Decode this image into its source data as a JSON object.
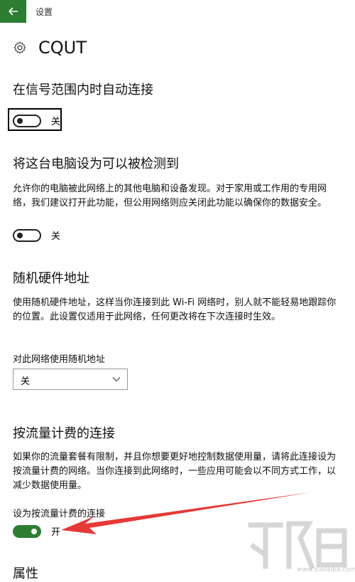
{
  "window": {
    "title": "设置"
  },
  "network": {
    "name": "CQUT"
  },
  "sections": {
    "auto_connect": {
      "title": "在信号范围内时自动连接",
      "toggle_label": "关"
    },
    "discoverable": {
      "title": "将这台电脑设为可以被检测到",
      "description": "允许你的电脑被此网络上的其他电脑和设备发现。对于家用或工作用的专用网络，我们建议打开此功能，但公用网络则应关闭此功能以确保你的数据安全。",
      "toggle_label": "关"
    },
    "random_mac": {
      "title": "随机硬件地址",
      "description": "使用随机硬件地址，这样当你连接到此 Wi-Fi 网络时，别人就不能轻易地跟踪你的位置。此设置仅适用于此网络，任何更改将在下次连接时生效。",
      "dropdown_label": "对此网络使用随机地址",
      "dropdown_value": "关"
    },
    "metered": {
      "title": "按流量计费的连接",
      "description": "如果你的流量套餐有限制，并且你想要更好地控制数据使用量，请将此连接设为按流量计费的网络。当你连接到此网络时，一些应用可能会以不同方式工作，以减少数据使用量。",
      "toggle_caption": "设为按流量计费的连接",
      "toggle_label": "开"
    },
    "properties": {
      "title": "属性"
    }
  },
  "watermark": {
    "text": "www.xiazaiba.com"
  },
  "colors": {
    "accent": "#2d7d32",
    "annotation_arrow": "#e53935"
  },
  "icons": {
    "back": "back-arrow-icon",
    "settings": "gear-icon",
    "dropdown": "chevron-down-icon"
  },
  "toggles": {
    "auto_connect": false,
    "discoverable": false,
    "metered": true
  }
}
